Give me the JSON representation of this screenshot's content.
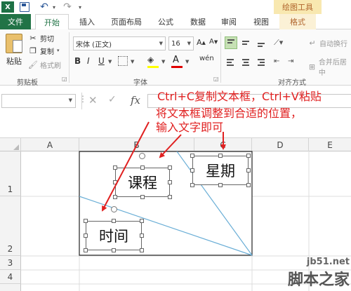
{
  "quick_access": {
    "app_icon": "X",
    "save_icon": "save-icon",
    "undo_icon": "undo-icon",
    "redo_icon": "redo-icon",
    "contextual_group": "绘图工具"
  },
  "tabs": {
    "file": "文件",
    "home": "开始",
    "insert": "插入",
    "page_layout": "页面布局",
    "formulas": "公式",
    "data": "数据",
    "review": "审阅",
    "view": "视图",
    "format": "格式"
  },
  "ribbon": {
    "clipboard": {
      "paste": "粘贴",
      "cut": "剪切",
      "copy": "复制",
      "format_painter": "格式刷",
      "label": "剪贴板"
    },
    "font": {
      "name": "宋体 (正文)",
      "size": "16",
      "grow": "A",
      "shrink": "A",
      "bold": "B",
      "italic": "I",
      "underline": "U",
      "phonetic": "wén",
      "font_color_glyph": "A",
      "label": "字体",
      "fill_color": "#ffff00",
      "font_color": "#e00000"
    },
    "alignment": {
      "wrap_text": "自动换行",
      "merge_center": "合并后居中",
      "label": "对齐方式"
    }
  },
  "formula_bar": {
    "fx": "fx"
  },
  "sheet": {
    "columns": [
      "A",
      "B",
      "C",
      "D",
      "E"
    ],
    "rows": [
      "1",
      "2",
      "3",
      "4"
    ]
  },
  "annotation": {
    "line1": "Ctrl+C复制文本框，Ctrl+V粘贴",
    "line2": "将文本框调整到合适的位置，",
    "line3": "输入文字即可",
    "color": "#e02020"
  },
  "textboxes": {
    "course": "课程",
    "week": "星期",
    "time": "时间"
  },
  "watermark": {
    "site": "jb51.net",
    "name": "脚本之家"
  }
}
